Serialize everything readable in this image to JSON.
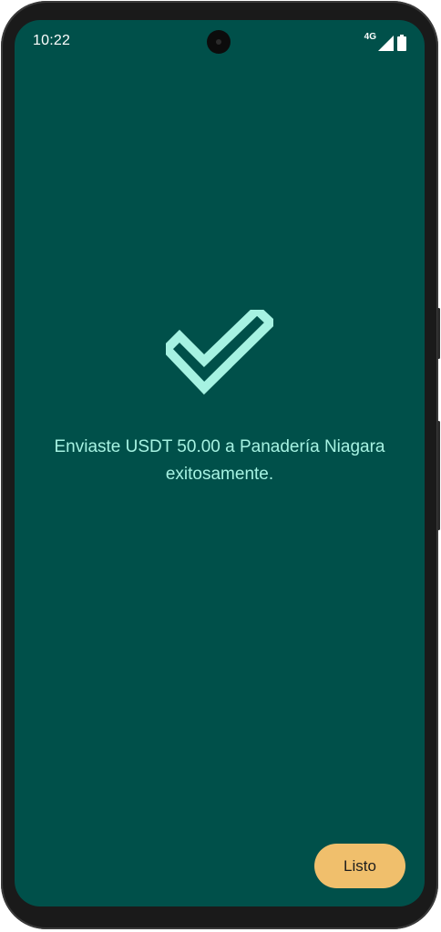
{
  "status_bar": {
    "time": "10:22",
    "network": "4G",
    "icons": [
      "signal-icon",
      "battery-icon"
    ]
  },
  "confirmation": {
    "icon": "checkmark-icon",
    "message": "Enviaste USDT 50.00 a Panadería Niagara exitosamente."
  },
  "actions": {
    "done_label": "Listo"
  },
  "colors": {
    "background": "#00504a",
    "accent": "#a6f2e2",
    "button": "#f0bf6c",
    "button_text": "#1d1d1d"
  }
}
